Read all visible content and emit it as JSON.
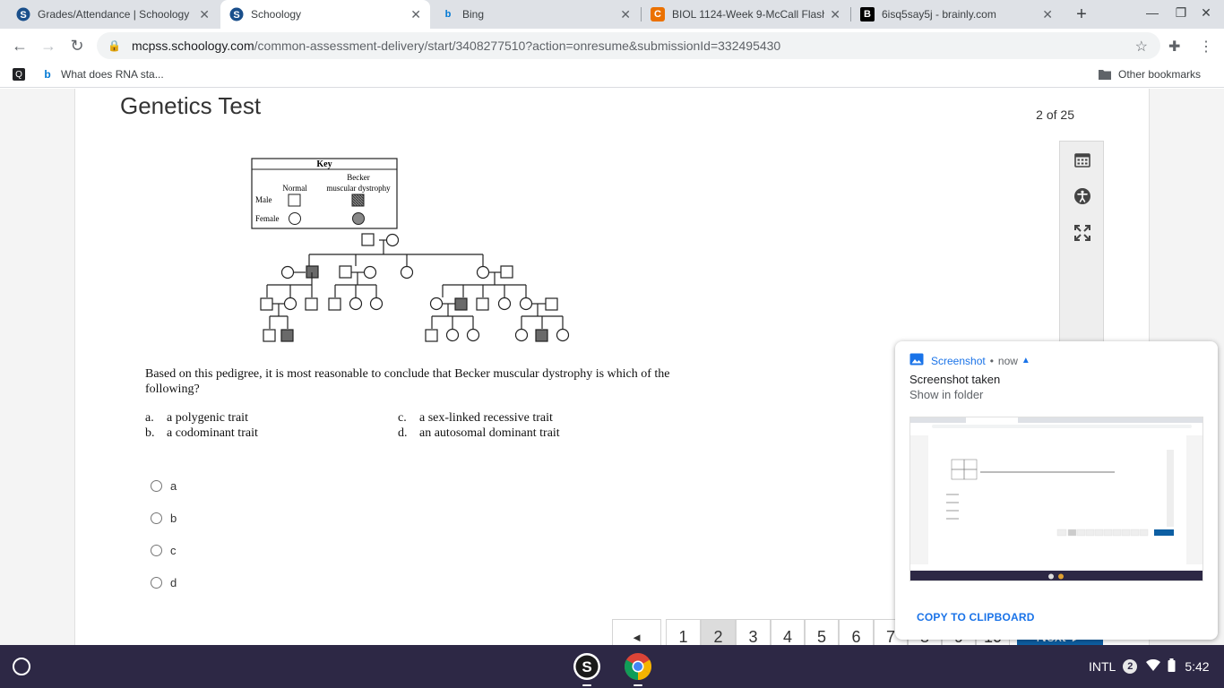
{
  "browser": {
    "tabs": [
      {
        "title": "Grades/Attendance | Schoology",
        "favicon": "S"
      },
      {
        "title": "Schoology",
        "favicon": "S"
      },
      {
        "title": "Bing",
        "favicon": "b"
      },
      {
        "title": "BIOL 1124-Week 9-McCall Flash",
        "favicon": "C"
      },
      {
        "title": "6isq5say5j - brainly.com",
        "favicon": "B"
      }
    ],
    "active_tab": 1,
    "url_host": "mcpss.schoology.com",
    "url_path": "/common-assessment-delivery/start/3408277510?action=onresume&submissionId=332495430",
    "bookmarks": [
      {
        "label": "",
        "icon": "q-icon"
      },
      {
        "label": "What does RNA sta...",
        "icon": "bing-icon"
      }
    ],
    "other_bookmarks": "Other bookmarks"
  },
  "assessment": {
    "title": "Genetics Test",
    "progress": "2 of 25",
    "pedigree": {
      "key_title": "Key",
      "col_normal": "Normal",
      "col_becker_1": "Becker",
      "col_becker_2": "muscular dystrophy",
      "row_male": "Male",
      "row_female": "Female"
    },
    "question": "Based on this pedigree, it is most reasonable to conclude that Becker muscular dystrophy is which of the following?",
    "options": [
      {
        "letter": "a.",
        "text": "a polygenic trait"
      },
      {
        "letter": "b.",
        "text": "a codominant trait"
      },
      {
        "letter": "c.",
        "text": "a sex-linked recessive trait"
      },
      {
        "letter": "d.",
        "text": "an autosomal dominant trait"
      }
    ],
    "choices": [
      "a",
      "b",
      "c",
      "d"
    ],
    "pager": {
      "prev": "◄",
      "pages": [
        "1",
        "2",
        "3",
        "4",
        "5",
        "6",
        "7",
        "8",
        "9",
        "10"
      ],
      "current": "2",
      "next": "Next ►"
    }
  },
  "notification": {
    "app": "Screenshot",
    "time": "now",
    "title": "Screenshot taken",
    "subtitle": "Show in folder",
    "action": "COPY TO CLIPBOARD"
  },
  "shelf": {
    "ime": "INTL",
    "badge_count": "2",
    "time": "5:42"
  },
  "colors": {
    "tabstrip": "#dee1e6",
    "shelf": "#2d2845",
    "next_button": "#0d5fa3",
    "notification_accent": "#1a73e8"
  }
}
